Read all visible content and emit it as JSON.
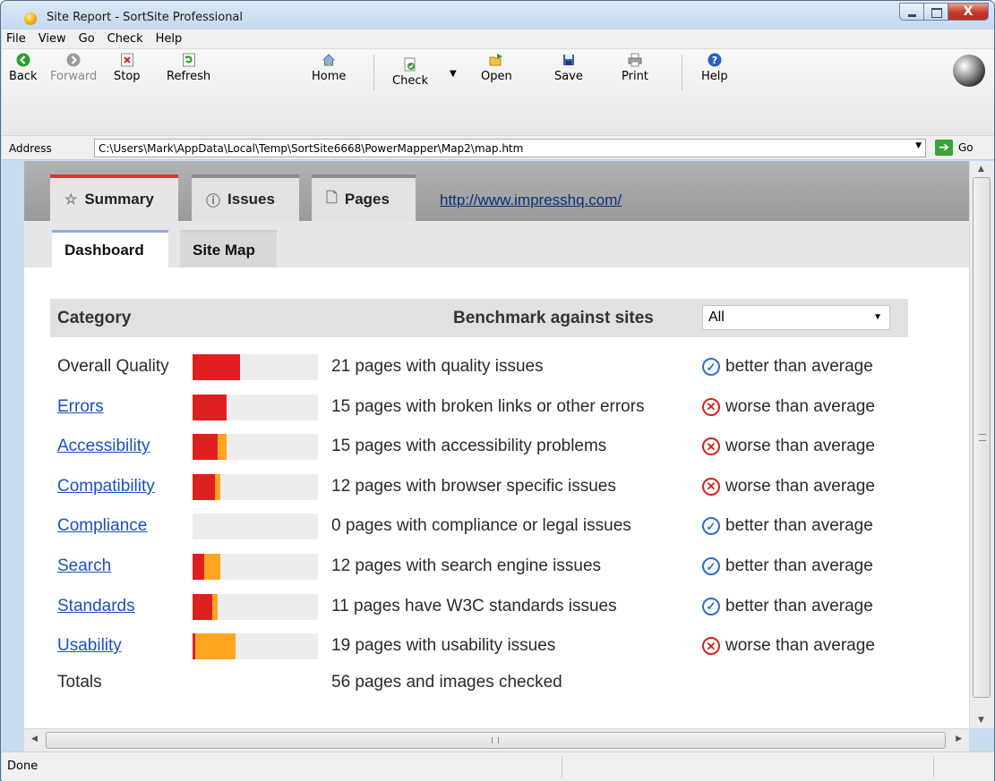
{
  "window": {
    "title": "Site Report - SortSite Professional",
    "close_glyph": "X"
  },
  "menu": [
    "File",
    "View",
    "Go",
    "Check",
    "Help"
  ],
  "toolbar": {
    "back": "Back",
    "forward": "Forward",
    "stop": "Stop",
    "refresh": "Refresh",
    "home": "Home",
    "check": "Check",
    "open": "Open",
    "save": "Save",
    "print": "Print",
    "help": "Help"
  },
  "address": {
    "label": "Address",
    "value": "C:\\Users\\Mark\\AppData\\Local\\Temp\\SortSite6668\\PowerMapper\\Map2\\map.htm",
    "go": "Go"
  },
  "tabs": {
    "summary": "Summary",
    "issues": "Issues",
    "pages": "Pages",
    "site_url": "http://www.impresshq.com/"
  },
  "subtabs": {
    "dashboard": "Dashboard",
    "sitemap": "Site Map"
  },
  "dashboard": {
    "category_header": "Category",
    "benchmark_header": "Benchmark against sites",
    "benchmark_select": "All",
    "rows": [
      {
        "label": "Overall Quality",
        "link": false,
        "red": 0.38,
        "orange": 0.0,
        "desc": "21 pages with quality issues",
        "status": "good",
        "bench": "better than average"
      },
      {
        "label": "Errors",
        "link": true,
        "red": 0.27,
        "orange": 0.0,
        "desc": "15 pages with broken links or other errors",
        "status": "bad",
        "bench": "worse than average"
      },
      {
        "label": "Accessibility",
        "link": true,
        "red": 0.2,
        "orange": 0.07,
        "desc": "15 pages with accessibility problems",
        "status": "bad",
        "bench": "worse than average"
      },
      {
        "label": "Compatibility",
        "link": true,
        "red": 0.18,
        "orange": 0.04,
        "desc": "12 pages with browser specific issues",
        "status": "bad",
        "bench": "worse than average"
      },
      {
        "label": "Compliance",
        "link": true,
        "red": 0.0,
        "orange": 0.0,
        "desc": "0 pages with compliance or legal issues",
        "status": "good",
        "bench": "better than average"
      },
      {
        "label": "Search",
        "link": true,
        "red": 0.09,
        "orange": 0.13,
        "desc": "12 pages with search engine issues",
        "status": "good",
        "bench": "better than average"
      },
      {
        "label": "Standards",
        "link": true,
        "red": 0.16,
        "orange": 0.04,
        "desc": "11 pages have W3C standards issues",
        "status": "good",
        "bench": "better than average"
      },
      {
        "label": "Usability",
        "link": true,
        "red": 0.02,
        "orange": 0.32,
        "desc": "19 pages with usability issues",
        "status": "bad",
        "bench": "worse than average"
      }
    ],
    "totals_label": "Totals",
    "totals_desc": "56 pages and images checked"
  },
  "colors": {
    "bar_red": "#df1f1f",
    "bar_orange": "#ffa51f",
    "good": "#2a6fd0",
    "bad": "#d72020",
    "link": "#1a4fc2"
  },
  "status_bar": {
    "text": "Done"
  }
}
